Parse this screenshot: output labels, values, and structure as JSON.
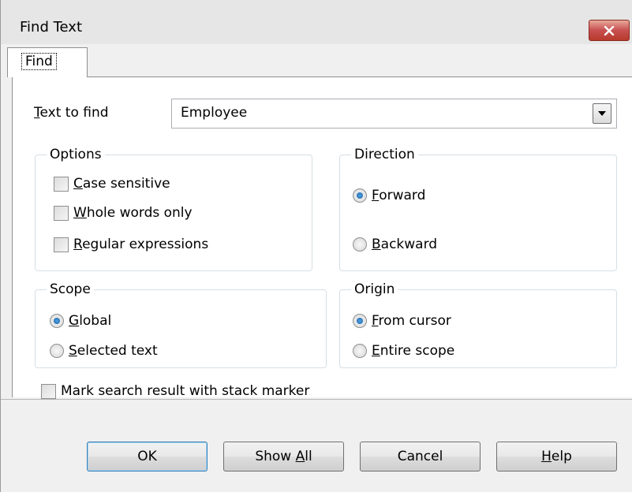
{
  "window": {
    "title": "Find Text"
  },
  "tabs": [
    {
      "label": "Find",
      "selected": true
    }
  ],
  "text_to_find": {
    "label": "Text to find",
    "value": "Employee"
  },
  "options": {
    "legend": "Options",
    "items": [
      {
        "label": "Case sensitive",
        "checked": false
      },
      {
        "label": "Whole words only",
        "checked": false
      },
      {
        "label": "Regular expressions",
        "checked": false
      }
    ]
  },
  "direction": {
    "legend": "Direction",
    "items": [
      {
        "label": "Forward",
        "selected": true
      },
      {
        "label": "Backward",
        "selected": false
      }
    ]
  },
  "scope": {
    "legend": "Scope",
    "items": [
      {
        "label": "Global",
        "selected": true
      },
      {
        "label": "Selected text",
        "selected": false
      }
    ]
  },
  "origin": {
    "legend": "Origin",
    "items": [
      {
        "label": "From cursor",
        "selected": true
      },
      {
        "label": "Entire scope",
        "selected": false
      }
    ]
  },
  "mark_stack": {
    "label": "Mark search result with stack marker",
    "checked": false
  },
  "buttons": {
    "ok": "OK",
    "show_all": "Show All",
    "cancel": "Cancel",
    "help": "Help"
  },
  "icons": {
    "close": "close-icon",
    "dropdown": "chevron-down-icon"
  },
  "colors": {
    "close_button": "#c75050",
    "radio_selected": "#1c5fa8",
    "default_button_border": "#3c7fb1"
  }
}
